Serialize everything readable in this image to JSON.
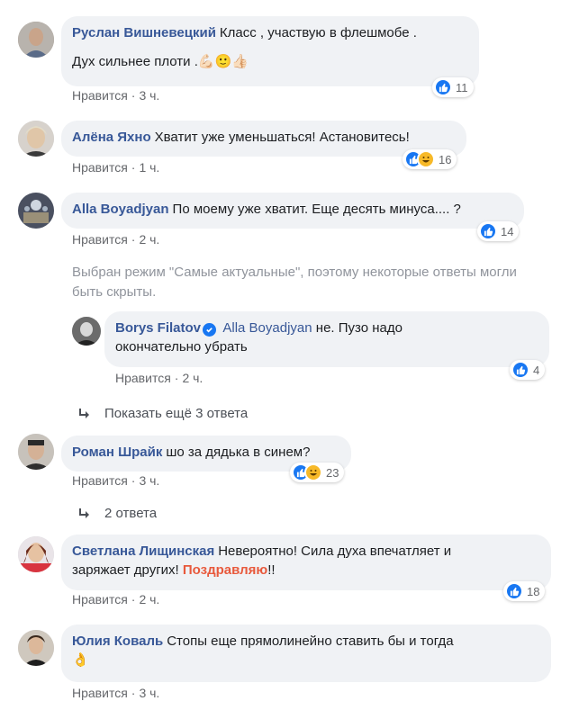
{
  "comments": [
    {
      "author": "Руслан Вишневецкий",
      "text_line1": "Класс , участвую в флешмобе .",
      "text_line2": "Дух сильнее плоти .",
      "emoji": "💪🏻🙂👍🏻",
      "like_label": "Нравится",
      "time": "3 ч.",
      "reaction_count": "11",
      "reactions": [
        "like"
      ]
    },
    {
      "author": "Алёна Яхно",
      "text": "Хватит уже уменьшаться! Астановитесь!",
      "like_label": "Нравится",
      "time": "1 ч.",
      "reaction_count": "16",
      "reactions": [
        "like",
        "haha"
      ]
    },
    {
      "author": "Alla Boyadjyan",
      "text": "По моему уже хватит. Еще десять минуса.... ?",
      "like_label": "Нравится",
      "time": "2 ч.",
      "reaction_count": "14",
      "reactions": [
        "like"
      ],
      "notice": "Выбран режим \"Самые актуальные\", поэтому некоторые ответы могли быть скрыты.",
      "reply": {
        "author": "Borys Filatov",
        "verified": true,
        "mention": "Alla Boyadjyan",
        "text_line1": "не. Пузо надо",
        "text_line2": "окончательно убрать",
        "like_label": "Нравится",
        "time": "2 ч.",
        "reaction_count": "4",
        "reactions": [
          "like"
        ]
      },
      "more_replies": "Показать ещё 3 ответа"
    },
    {
      "author": "Роман Шрайк",
      "text": "шо за дядька в синем?",
      "like_label": "Нравится",
      "time": "3 ч.",
      "reaction_count": "23",
      "reactions": [
        "like",
        "haha"
      ],
      "more_replies": "2 ответа"
    },
    {
      "author": "Светлана Лищинская",
      "text_line1": "Невероятно! Сила духа впечатляет и",
      "text_line2a": "заряжает других!",
      "highlight": "Поздравляю",
      "text_line2b": "!!",
      "like_label": "Нравится",
      "time": "2 ч.",
      "reaction_count": "18",
      "reactions": [
        "like"
      ]
    },
    {
      "author": "Юлия Коваль",
      "text": "Стопы еще прямолинейно ставить бы и тогда",
      "emoji": "👌",
      "like_label": "Нравится",
      "time": "3 ч."
    }
  ],
  "separator": "·",
  "colors": {
    "author": "#385898",
    "bubble": "#f0f2f5",
    "like_reaction": "#1877f2",
    "haha_reaction": "#f7b928",
    "muted": "#65676b",
    "highlight": "#e8593c"
  }
}
